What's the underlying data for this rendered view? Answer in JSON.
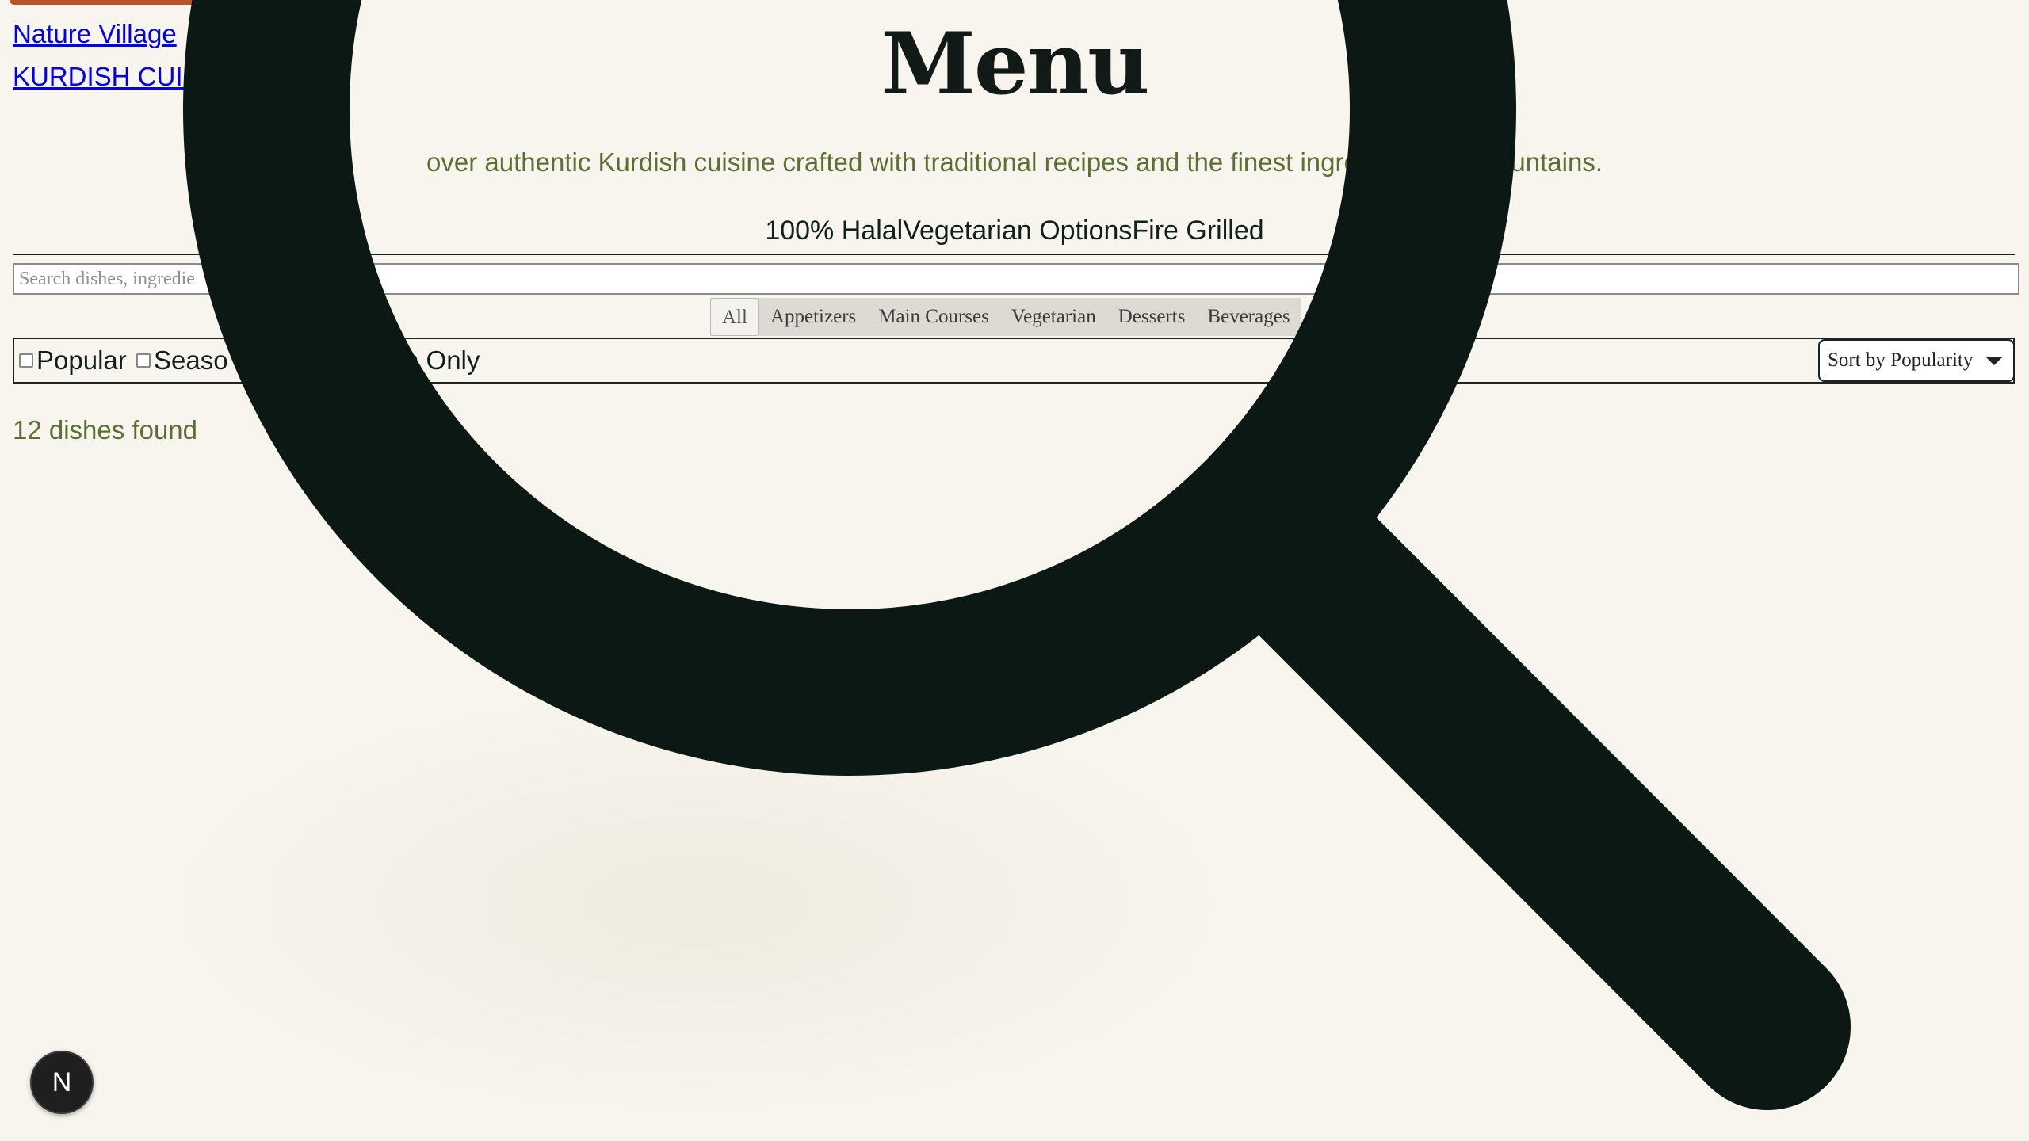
{
  "brand": {
    "name": "Nature Village",
    "tagline": "KURDISH CUISINE"
  },
  "hero": {
    "title": "Menu",
    "subtitle": "over authentic Kurdish cuisine crafted with traditional recipes and the finest ingredi                    Zagros Mountains."
  },
  "features": {
    "text": "100% HalalVegetarian OptionsFire Grilled"
  },
  "search": {
    "placeholder": "Search dishes, ingredie"
  },
  "categories": {
    "tabs": [
      {
        "label": "All",
        "active": true
      },
      {
        "label": "Appetizers"
      },
      {
        "label": "Main Courses"
      },
      {
        "label": "Vegetarian"
      },
      {
        "label": "Desserts"
      },
      {
        "label": "Beverages"
      }
    ]
  },
  "filters": {
    "items": [
      {
        "label": "Popular",
        "checked": false
      },
      {
        "label": "Seaso",
        "checked": false
      },
      {
        "label": "n Only"
      }
    ]
  },
  "sort": {
    "selected": "Sort by Popularity"
  },
  "results": {
    "count_text": "12 dishes found"
  },
  "overlay": {
    "icon": "magnifier-icon",
    "color": "#0c1814"
  },
  "badge": {
    "letter": "N"
  },
  "colors": {
    "accent": "#b9532a",
    "olive_text": "#5c7033",
    "background": "#f8f5ef",
    "dark": "#11201c"
  }
}
